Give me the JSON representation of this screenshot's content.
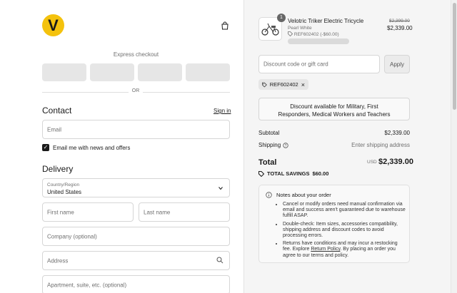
{
  "brand": {
    "logo_letter": "V",
    "accent": "#f4c20d"
  },
  "express": {
    "label": "Express checkout",
    "or": "OR"
  },
  "contact": {
    "heading": "Contact",
    "signin": "Sign in",
    "email_placeholder": "Email",
    "newsletter_label": "Email me with news and offers",
    "newsletter_checked": true
  },
  "delivery": {
    "heading": "Delivery",
    "country_label": "Country/Region",
    "country_value": "United States",
    "first_name": "First name",
    "last_name": "Last name",
    "company": "Company (optional)",
    "address": "Address",
    "apartment": "Apartment, suite, etc. (optional)"
  },
  "product": {
    "quantity": "1",
    "name": "Velotric Triker Electric Tricycle",
    "variant": "Pearl White",
    "discount_code": "REF602402 (-$60.00)",
    "original_price": "$2,399.00",
    "price": "$2,339.00"
  },
  "discount": {
    "placeholder": "Discount code or gift card",
    "apply": "Apply",
    "applied_code": "REF602402",
    "eligibility_button": "Discount available for Military, First Responders, Medical Workers and Teachers"
  },
  "summary": {
    "subtotal_label": "Subtotal",
    "subtotal_value": "$2,339.00",
    "shipping_label": "Shipping",
    "shipping_value": "Enter shipping address",
    "total_label": "Total",
    "currency": "USD",
    "total_value": "$2,339.00",
    "savings_label": "TOTAL SAVINGS",
    "savings_value": "$60.00"
  },
  "notes": {
    "title": "Notes about your order",
    "items": [
      "Cancel or modify orders need manual confirmation via email and success aren't guaranteed due to warehouse fulfill ASAP.",
      "Double-check: Item sizes, accessories compatibility, shipping address and discount codes to avoid processing errors."
    ],
    "item3_before": "Returns have conditions and may incur a restocking fee. Explore ",
    "item3_link": "Return Policy",
    "item3_after": ". By placing an order you agree to our terms and policy."
  }
}
